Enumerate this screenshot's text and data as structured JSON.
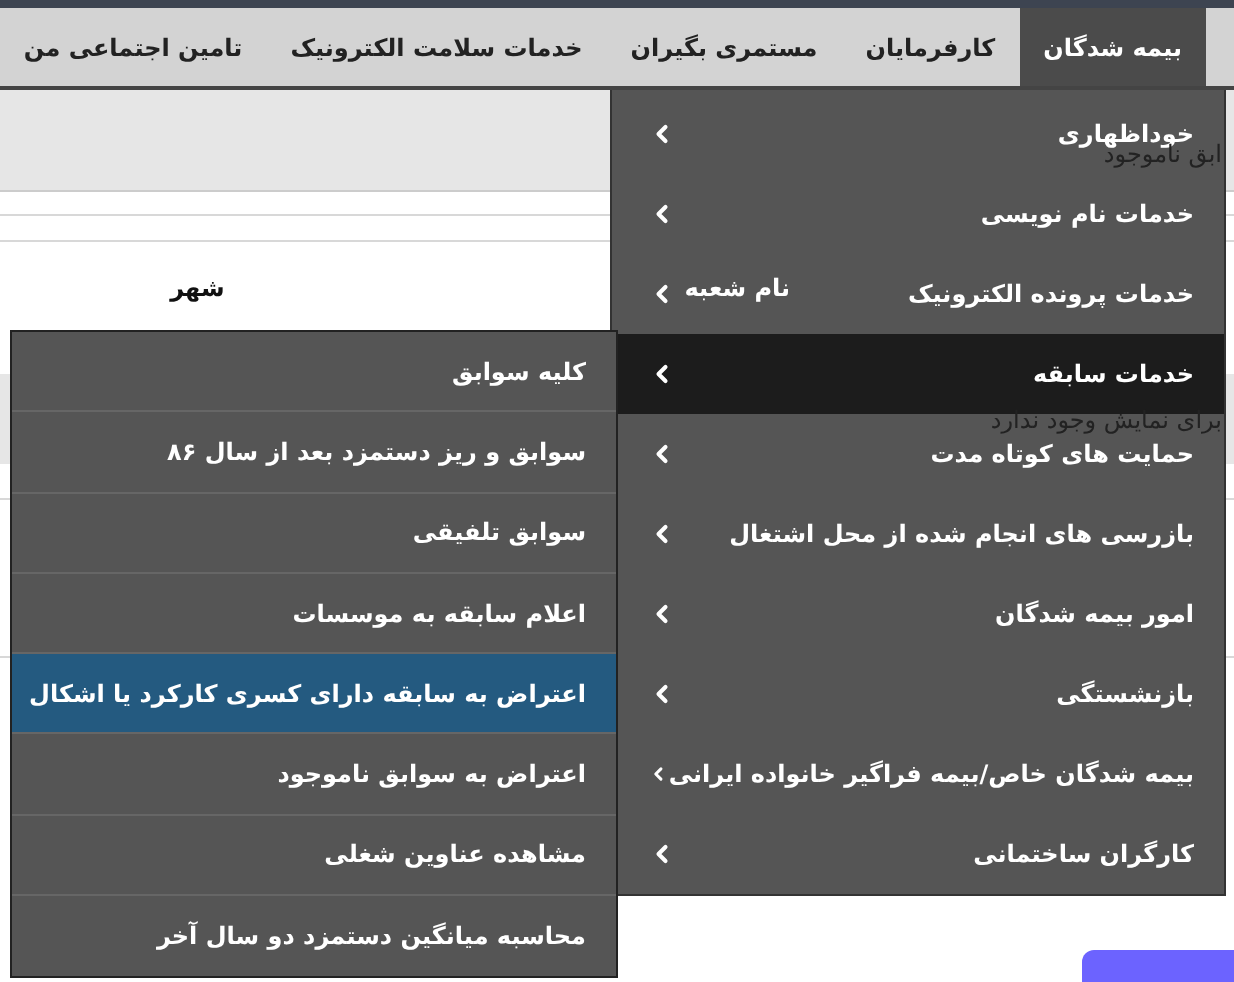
{
  "nav": {
    "tabs": [
      {
        "label": "بیمه شدگان",
        "selected": true
      },
      {
        "label": "کارفرمایان",
        "selected": false
      },
      {
        "label": "مستمری بگیران",
        "selected": false
      },
      {
        "label": "خدمات سلامت الکترونیک",
        "selected": false
      },
      {
        "label": "تامین اجتماعی من",
        "selected": false
      }
    ]
  },
  "page": {
    "notice_1": "ابق ناموجود",
    "columns": [
      "نام شعبه",
      "شهر"
    ],
    "notice_2": "برای نمایش وجود ندارد"
  },
  "menu": {
    "items": [
      {
        "label": "خوداظهاری",
        "selected": false
      },
      {
        "label": "خدمات نام نویسی",
        "selected": false
      },
      {
        "label": "خدمات پرونده الکترونیک",
        "selected": false
      },
      {
        "label": "خدمات سابقه",
        "selected": true
      },
      {
        "label": "حمایت های کوتاه مدت",
        "selected": false
      },
      {
        "label": "بازرسی های انجام شده از محل اشتغال",
        "selected": false
      },
      {
        "label": "امور بیمه شدگان",
        "selected": false
      },
      {
        "label": "بازنشستگی",
        "selected": false
      },
      {
        "label": "بیمه شدگان خاص/بیمه فراگیر خانواده ایرانی",
        "selected": false
      },
      {
        "label": "کارگران ساختمانی",
        "selected": false
      }
    ]
  },
  "submenu": {
    "items": [
      {
        "label": "کلیه سوابق",
        "selected": false
      },
      {
        "label": "سوابق و ریز دستمزد بعد از سال ۸۶",
        "selected": false
      },
      {
        "label": "سوابق تلفیقی",
        "selected": false
      },
      {
        "label": "اعلام سابقه به موسسات",
        "selected": false
      },
      {
        "label": "اعتراض به سابقه دارای کسری کارکرد یا اشکال",
        "selected": true
      },
      {
        "label": "اعتراض به سوابق ناموجود",
        "selected": false
      },
      {
        "label": "مشاهده عناوین شغلی",
        "selected": false
      },
      {
        "label": "محاسبه میانگین دستمزد دو سال آخر",
        "selected": false
      }
    ]
  }
}
